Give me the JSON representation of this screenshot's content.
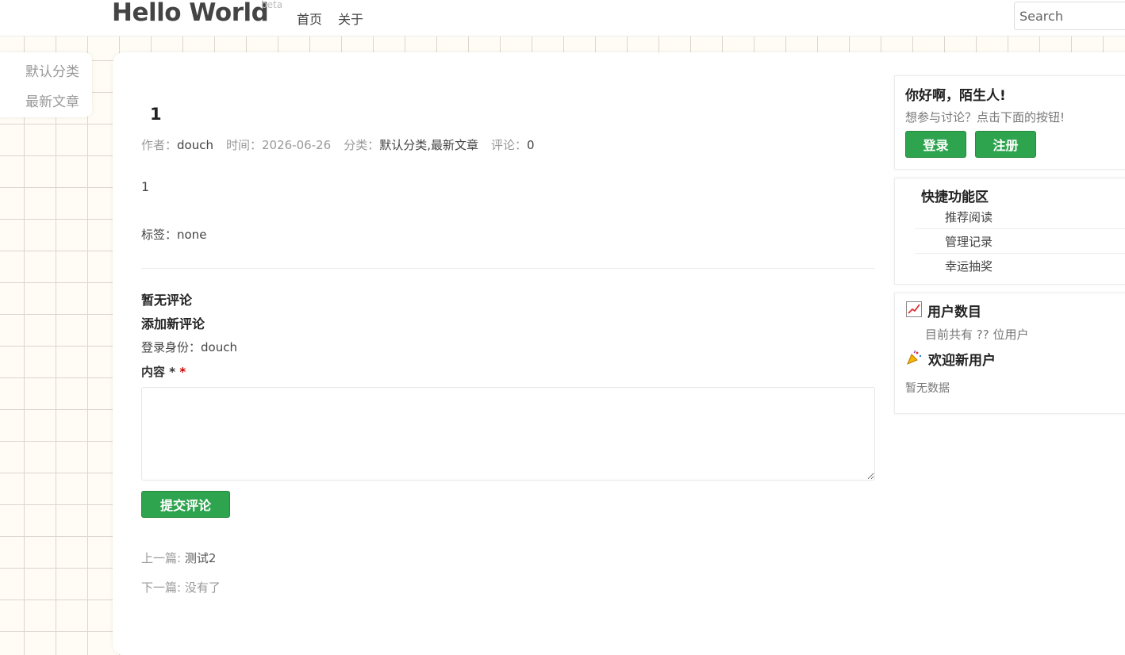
{
  "header": {
    "logo": "Hello World",
    "beta": "beta",
    "nav": [
      "首页",
      "关于"
    ],
    "search_placeholder": "Search"
  },
  "categories": [
    "默认分类",
    "最新文章"
  ],
  "post": {
    "title": "1",
    "author_label": "作者：",
    "author": "douch",
    "time_label": "时间：",
    "time": "2026-06-26",
    "category_label": "分类：",
    "category": "默认分类,最新文章",
    "comments_label": "评论：",
    "comments": "0",
    "body": "1",
    "tags": "标签：none"
  },
  "comments": {
    "empty": "暂无评论",
    "add_title": "添加新评论",
    "login_as": "登录身份：douch",
    "content_label": "内容 *",
    "required_mark": "*",
    "submit": "提交评论"
  },
  "post_nav": {
    "prev_label": "上一篇:",
    "prev": "测试2",
    "next_label": "下一篇:",
    "next": "没有了"
  },
  "sidebar": {
    "greeting": {
      "title": "你好啊，陌生人!",
      "text": "想参与讨论？点击下面的按钮!",
      "login": "登录",
      "register": "注册"
    },
    "quick": {
      "title": "快捷功能区",
      "items": [
        "推荐阅读",
        "管理记录",
        "幸运抽奖"
      ]
    },
    "users": {
      "title": "用户数目",
      "text": "目前共有 ?? 位用户",
      "welcome_title": "欢迎新用户",
      "welcome_text": "暂无数据",
      "icons": [
        "chart-icon",
        "party-popper-icon"
      ]
    }
  },
  "colors": {
    "accent_green": "#2ea44f",
    "background": "#fffbf5"
  }
}
